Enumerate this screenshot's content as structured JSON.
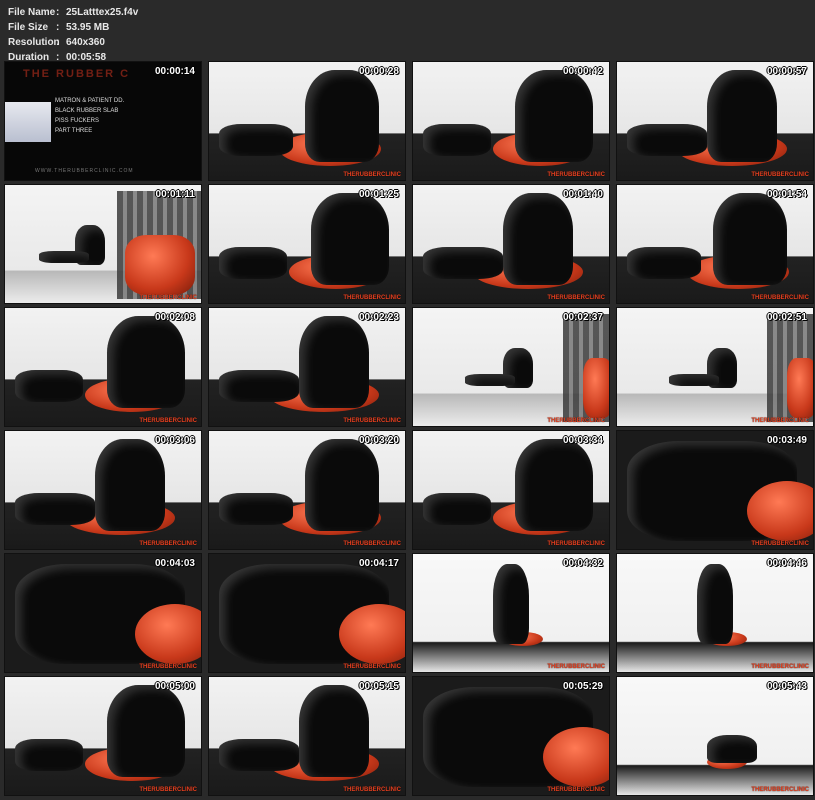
{
  "header": {
    "file_name_label": "File Name",
    "file_name": "25Latttex25.f4v",
    "file_size_label": "File Size",
    "file_size": "53.95 MB",
    "resolution_label": "Resolution",
    "resolution": "640x360",
    "duration_label": "Duration",
    "duration": "00:05:58",
    "separator": ":"
  },
  "title_frame": {
    "logo": "THE RUBBER C",
    "line1": "MATRON & PATIENT DD.",
    "line2": "BLACK RUBBER SLAB",
    "line3": "PISS FUCKERS",
    "line4": "PART THREE",
    "footer": "WWW.THERUBBERCLINIC.COM"
  },
  "watermark": "THERUBBERCLINIC",
  "thumbnails": [
    {
      "time": "00:00:14",
      "scene": "title"
    },
    {
      "time": "00:00:28",
      "scene": "bright"
    },
    {
      "time": "00:00:42",
      "scene": "bright"
    },
    {
      "time": "00:00:57",
      "scene": "bright"
    },
    {
      "time": "00:01:11",
      "scene": "wide"
    },
    {
      "time": "00:01:25",
      "scene": "bright"
    },
    {
      "time": "00:01:40",
      "scene": "bright"
    },
    {
      "time": "00:01:54",
      "scene": "bright"
    },
    {
      "time": "00:02:08",
      "scene": "bright"
    },
    {
      "time": "00:02:23",
      "scene": "bright"
    },
    {
      "time": "00:02:37",
      "scene": "wide"
    },
    {
      "time": "00:02:51",
      "scene": "wide"
    },
    {
      "time": "00:03:06",
      "scene": "bright"
    },
    {
      "time": "00:03:20",
      "scene": "bright"
    },
    {
      "time": "00:03:34",
      "scene": "bright"
    },
    {
      "time": "00:03:49",
      "scene": "dark"
    },
    {
      "time": "00:04:03",
      "scene": "dark"
    },
    {
      "time": "00:04:17",
      "scene": "dark"
    },
    {
      "time": "00:04:32",
      "scene": "studio"
    },
    {
      "time": "00:04:46",
      "scene": "studio"
    },
    {
      "time": "00:05:00",
      "scene": "bright"
    },
    {
      "time": "00:05:15",
      "scene": "bright"
    },
    {
      "time": "00:05:29",
      "scene": "dark"
    },
    {
      "time": "00:05:43",
      "scene": "studio"
    }
  ]
}
